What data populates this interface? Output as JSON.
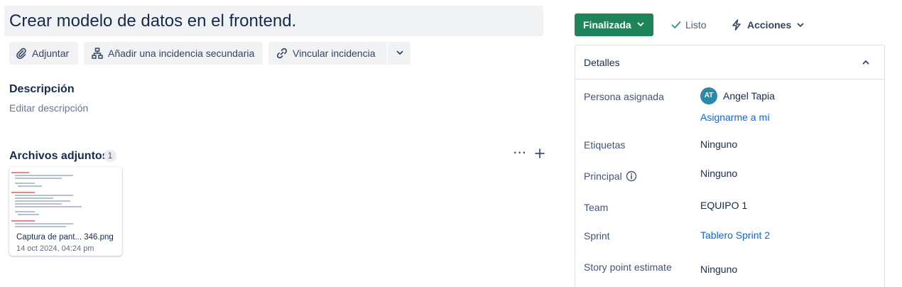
{
  "issue": {
    "title": "Crear modelo de datos en el frontend."
  },
  "toolbar": {
    "attach_label": "Adjuntar",
    "child_issue_label": "Añadir una incidencia secundaria",
    "link_issue_label": "Vincular incidencia"
  },
  "description": {
    "heading": "Descripción",
    "placeholder": "Editar descripción"
  },
  "attachments": {
    "heading": "Archivos adjuntos",
    "count": "1",
    "files": [
      {
        "name": "Captura de pant... 346.png",
        "date": "14 oct 2024, 04:24 pm"
      }
    ]
  },
  "status": {
    "label": "Finalizada",
    "done_label": "Listo",
    "actions_label": "Acciones",
    "accent": "#1f845a"
  },
  "details": {
    "heading": "Detalles",
    "assignee_label": "Persona asignada",
    "assignee_initials": "AT",
    "assignee_name": "Angel Tapia",
    "assign_me": "Asignarme a mí",
    "labels_label": "Etiquetas",
    "labels_value": "Ninguno",
    "parent_label": "Principal",
    "parent_value": "Ninguno",
    "team_label": "Team",
    "team_value": "EQUIPO 1",
    "sprint_label": "Sprint",
    "sprint_value": "Tablero Sprint 2",
    "story_points_label": "Story point estimate",
    "story_points_value": "Ninguno"
  }
}
